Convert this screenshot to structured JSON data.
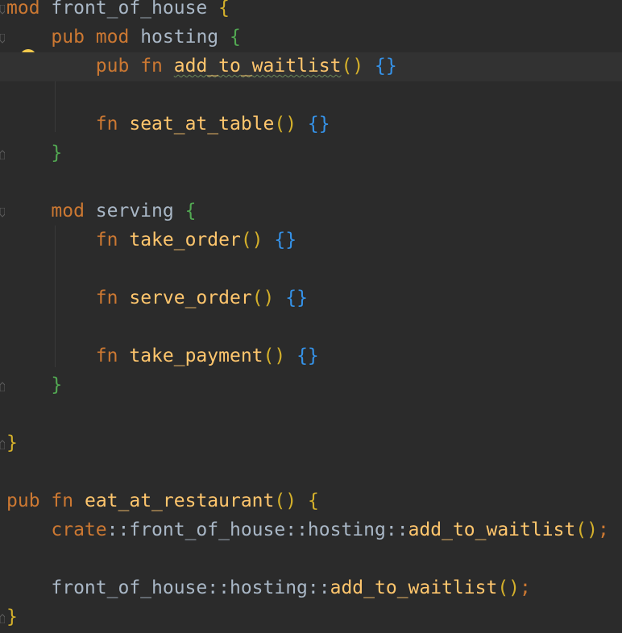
{
  "editor": {
    "language": "rust",
    "lines": [
      {
        "tokens": [
          [
            "mod",
            "kw"
          ],
          [
            " ",
            "sp"
          ],
          [
            "front_of_house",
            "name"
          ],
          [
            " ",
            "sp"
          ],
          [
            "{",
            "brace-y"
          ]
        ]
      },
      {
        "tokens": [
          [
            "    ",
            "sp"
          ],
          [
            "pub",
            "kw"
          ],
          [
            " ",
            "sp"
          ],
          [
            "mod",
            "kw"
          ],
          [
            " ",
            "sp"
          ],
          [
            "hosting",
            "name"
          ],
          [
            " ",
            "sp"
          ],
          [
            "{",
            "brace-g"
          ]
        ]
      },
      {
        "tokens": [
          [
            "        ",
            "sp"
          ],
          [
            "pub",
            "kw"
          ],
          [
            " ",
            "sp"
          ],
          [
            "fn",
            "kw"
          ],
          [
            " ",
            "sp"
          ],
          [
            "add_to_waitlist",
            "fn-sq"
          ],
          [
            "()",
            "paren"
          ],
          [
            " ",
            "sp"
          ],
          [
            "{}",
            "brace-b"
          ]
        ]
      },
      {
        "tokens": []
      },
      {
        "tokens": [
          [
            "        ",
            "sp"
          ],
          [
            "fn",
            "kw"
          ],
          [
            " ",
            "sp"
          ],
          [
            "seat_at_table",
            "fn"
          ],
          [
            "()",
            "paren"
          ],
          [
            " ",
            "sp"
          ],
          [
            "{}",
            "brace-b"
          ]
        ]
      },
      {
        "tokens": [
          [
            "    ",
            "sp"
          ],
          [
            "}",
            "brace-g"
          ]
        ]
      },
      {
        "tokens": []
      },
      {
        "tokens": [
          [
            "    ",
            "sp"
          ],
          [
            "mod",
            "kw"
          ],
          [
            " ",
            "sp"
          ],
          [
            "serving",
            "name"
          ],
          [
            " ",
            "sp"
          ],
          [
            "{",
            "brace-g"
          ]
        ]
      },
      {
        "tokens": [
          [
            "        ",
            "sp"
          ],
          [
            "fn",
            "kw"
          ],
          [
            " ",
            "sp"
          ],
          [
            "take_order",
            "fn"
          ],
          [
            "()",
            "paren"
          ],
          [
            " ",
            "sp"
          ],
          [
            "{}",
            "brace-b"
          ]
        ]
      },
      {
        "tokens": []
      },
      {
        "tokens": [
          [
            "        ",
            "sp"
          ],
          [
            "fn",
            "kw"
          ],
          [
            " ",
            "sp"
          ],
          [
            "serve_order",
            "fn"
          ],
          [
            "()",
            "paren"
          ],
          [
            " ",
            "sp"
          ],
          [
            "{}",
            "brace-b"
          ]
        ]
      },
      {
        "tokens": []
      },
      {
        "tokens": [
          [
            "        ",
            "sp"
          ],
          [
            "fn",
            "kw"
          ],
          [
            " ",
            "sp"
          ],
          [
            "take_payment",
            "fn"
          ],
          [
            "()",
            "paren"
          ],
          [
            " ",
            "sp"
          ],
          [
            "{}",
            "brace-b"
          ]
        ]
      },
      {
        "tokens": [
          [
            "    ",
            "sp"
          ],
          [
            "}",
            "brace-g"
          ]
        ]
      },
      {
        "tokens": []
      },
      {
        "tokens": [
          [
            "}",
            "brace-y"
          ]
        ]
      },
      {
        "tokens": []
      },
      {
        "tokens": [
          [
            "pub",
            "kw"
          ],
          [
            " ",
            "sp"
          ],
          [
            "fn",
            "kw"
          ],
          [
            " ",
            "sp"
          ],
          [
            "eat_at_restaurant",
            "fn"
          ],
          [
            "()",
            "paren"
          ],
          [
            " ",
            "sp"
          ],
          [
            "{",
            "brace-y"
          ]
        ]
      },
      {
        "tokens": [
          [
            "    ",
            "sp"
          ],
          [
            "crate",
            "kw"
          ],
          [
            "::",
            "sep"
          ],
          [
            "front_of_house",
            "path"
          ],
          [
            "::",
            "sep"
          ],
          [
            "hosting",
            "path"
          ],
          [
            "::",
            "sep"
          ],
          [
            "add_to_waitlist",
            "fn"
          ],
          [
            "()",
            "paren"
          ],
          [
            ";",
            "semi"
          ]
        ]
      },
      {
        "tokens": []
      },
      {
        "tokens": [
          [
            "    ",
            "sp"
          ],
          [
            "front_of_house",
            "path"
          ],
          [
            "::",
            "sep"
          ],
          [
            "hosting",
            "path"
          ],
          [
            "::",
            "sep"
          ],
          [
            "add_to_waitlist",
            "fn"
          ],
          [
            "()",
            "paren"
          ],
          [
            ";",
            "semi"
          ]
        ]
      },
      {
        "tokens": [
          [
            "}",
            "brace-y"
          ]
        ]
      }
    ],
    "current_line": 2,
    "intention_bulb_icon": "lightbulb-icon"
  },
  "colors": {
    "background": "#2b2b2b",
    "current_line": "#323232",
    "keyword": "#cc7832",
    "function": "#ffc66d",
    "identifier": "#a9b7c6",
    "brace_outer": "#d4b02b",
    "brace_inner": "#52a852",
    "brace_empty": "#3592e8",
    "bulb": "#f2c94c"
  }
}
